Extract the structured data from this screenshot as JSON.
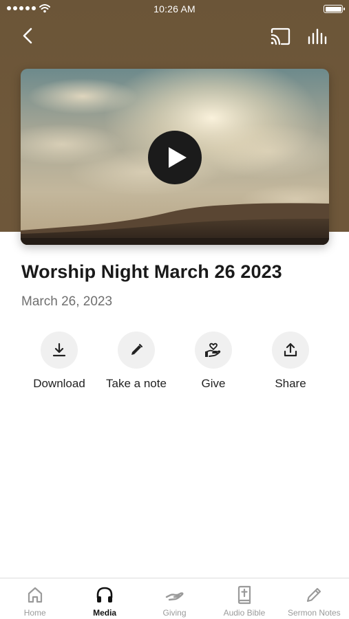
{
  "status_bar": {
    "time": "10:26 AM"
  },
  "nav": {
    "back_icon": "chevron-left-icon",
    "cast_icon": "cast-icon",
    "audio_icon": "equalizer-icon"
  },
  "media": {
    "title": "Worship Night March 26 2023",
    "date": "March 26, 2023",
    "play_icon": "play-icon"
  },
  "actions": [
    {
      "label": "Download",
      "icon": "download-icon"
    },
    {
      "label": "Take a note",
      "icon": "pencil-icon"
    },
    {
      "label": "Give",
      "icon": "hand-heart-icon"
    },
    {
      "label": "Share",
      "icon": "share-icon"
    }
  ],
  "tabbar": {
    "active": "Media",
    "items": [
      {
        "label": "Home",
        "icon": "home-icon"
      },
      {
        "label": "Media",
        "icon": "headphones-icon"
      },
      {
        "label": "Giving",
        "icon": "giving-hand-icon"
      },
      {
        "label": "Audio Bible",
        "icon": "bible-icon"
      },
      {
        "label": "Sermon Notes",
        "icon": "pencil-icon"
      }
    ]
  },
  "colors": {
    "header_brown": "#6e573a",
    "action_circle": "#f0f0f0",
    "tab_active": "#111111",
    "tab_inactive": "#9a9a9a"
  }
}
